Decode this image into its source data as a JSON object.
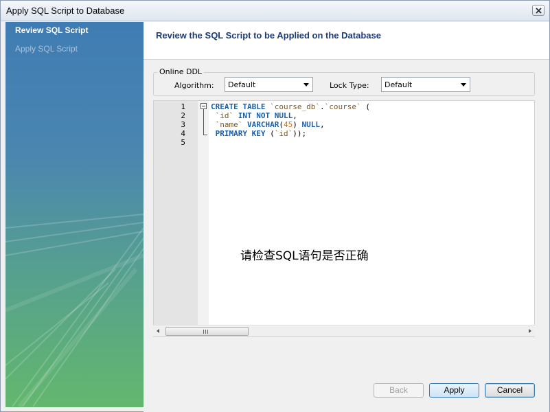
{
  "window": {
    "title": "Apply SQL Script to Database",
    "close_icon": "close-icon"
  },
  "sidebar": {
    "steps": [
      {
        "label": "Review SQL Script",
        "active": true
      },
      {
        "label": "Apply SQL Script",
        "active": false
      }
    ]
  },
  "header": {
    "title": "Review the SQL Script to be Applied on the Database"
  },
  "online_ddl": {
    "legend": "Online DDL",
    "algorithm_label": "Algorithm:",
    "algorithm_value": "Default",
    "lock_type_label": "Lock Type:",
    "lock_type_value": "Default"
  },
  "editor": {
    "line_numbers": [
      "1",
      "2",
      "3",
      "4",
      "5"
    ],
    "lines": [
      {
        "kw1": "CREATE TABLE",
        "t1": " ",
        "id1": "`course_db`",
        "t2": ".",
        "id2": "`course`",
        "t3": " ("
      },
      {
        "t1": " ",
        "id1": "`id`",
        "t2": " ",
        "kw1": "INT NOT NULL",
        "t3": ","
      },
      {
        "t1": " ",
        "id1": "`name`",
        "t2": " ",
        "kw1": "VARCHAR",
        "t3": "(",
        "num": "45",
        "t4": ") ",
        "kw2": "NULL",
        "t5": ","
      },
      {
        "t1": " ",
        "kw1": "PRIMARY KEY",
        "t2": " (",
        "id1": "`id`",
        "t3": "));"
      },
      {
        "t1": ""
      }
    ]
  },
  "note": "请检查SQL语句是否正确",
  "buttons": {
    "back": "Back",
    "apply": "Apply",
    "cancel": "Cancel"
  },
  "colors": {
    "sidebar_top": "#3f7cb3",
    "sidebar_bottom": "#63b76d",
    "header_title": "#1c3b7b",
    "keyword": "#1a5fa8",
    "identifier": "#7a5a2a",
    "number": "#d07020"
  }
}
